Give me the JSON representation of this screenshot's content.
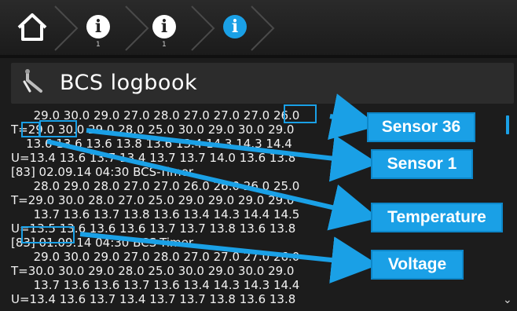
{
  "title": "BCS logbook",
  "breadcrumb": {
    "home_icon": "home-icon",
    "steps": [
      {
        "icon": "info-icon",
        "glyph": "i",
        "sub": "1",
        "active": false
      },
      {
        "icon": "info-icon",
        "glyph": "i",
        "sub": "1",
        "active": false
      },
      {
        "icon": "info-icon",
        "glyph": "i",
        "sub": "",
        "active": true
      }
    ]
  },
  "log_lines": [
    "      29.0 30.0 29.0 27.0 28.0 27.0 27.0 27.0 26.0",
    "T=29.0 30.0 29.0 28.0 25.0 30.0 29.0 30.0 29.0",
    "    13.6 13.6 13.6 13.8 13.6 13.4 14.3 14.3 14.4",
    "U=13.4 13.6 13.7 13.4 13.7 13.7 14.0 13.6 13.8",
    "[83] 02.09.14 04:30 BCS-Timer",
    "      28.0 29.0 28.0 27.0 27.0 26.0 26.0 26.0 25.0",
    "T=29.0 30.0 28.0 27.0 25.0 29.0 29.0 29.0 29.0",
    "      13.7 13.6 13.7 13.8 13.6 13.4 14.3 14.4 14.5",
    "U=13.5 13.6 13.6 13.6 13.7 13.7 13.8 13.6 13.8",
    "[83] 01.09.14 04:30 BCS-Timer",
    "      29.0 30.0 29.0 27.0 28.0 27.0 27.0 27.0 26.0",
    "T=30.0 30.0 29.0 28.0 25.0 30.0 29.0 30.0 29.0",
    "      13.7 13.6 13.6 13.7 13.6 13.4 14.3 14.3 14.4",
    "U=13.4 13.6 13.7 13.4 13.7 13.7 13.8 13.6 13.8"
  ],
  "callouts": {
    "sensor36": "Sensor 36",
    "sensor1": "Sensor 1",
    "temperature": "Temperature",
    "voltage": "Voltage"
  },
  "colors": {
    "accent": "#1aa0e6",
    "background": "#1c1c1c",
    "text": "#f2f2f2"
  },
  "icons": {
    "logbook": "wrench-icon",
    "scroll_down": "chevron-down-icon"
  }
}
